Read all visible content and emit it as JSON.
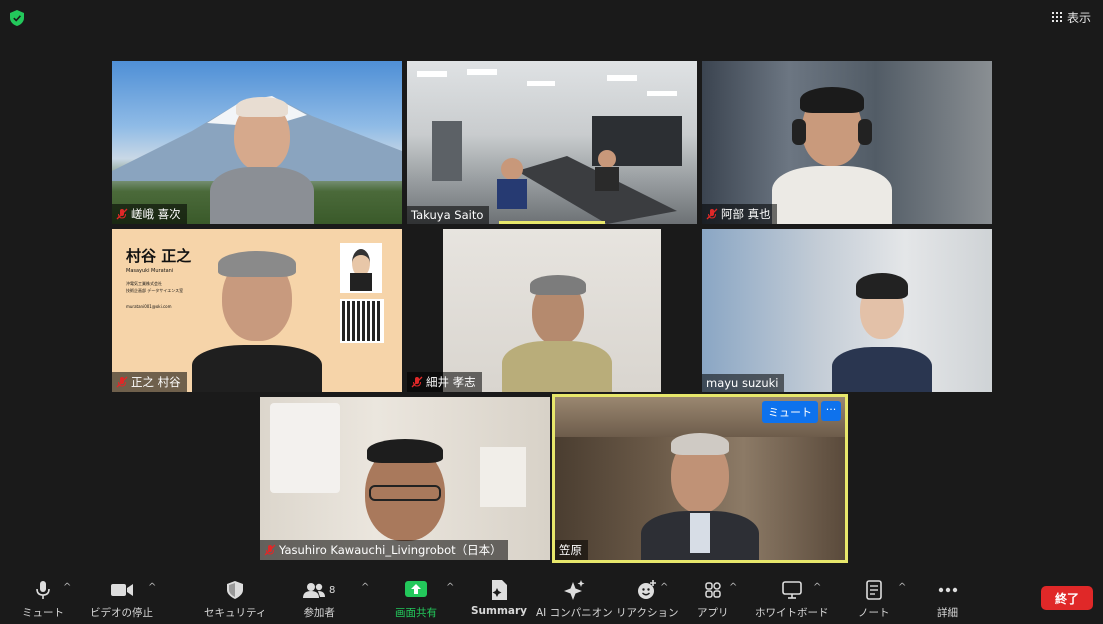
{
  "header": {
    "view_label": "表示"
  },
  "participants": [
    {
      "name": "嵯峨 喜次",
      "muted": true
    },
    {
      "name": "Takuya Saito",
      "muted": false
    },
    {
      "name": "阿部 真也",
      "muted": true
    },
    {
      "name": "正之 村谷",
      "muted": true
    },
    {
      "name": "細井 孝志",
      "muted": true
    },
    {
      "name": "mayu suzuki",
      "muted": false
    },
    {
      "name": "Yasuhiro Kawauchi_Livingrobot（日本）",
      "muted": true
    },
    {
      "name": "笠原",
      "muted": false
    }
  ],
  "background_card": {
    "name_jp": "村谷 正之",
    "name_en": "Masayuki Muratani",
    "company": "沖電気工業株式会社",
    "department": "技術企画部 データサイエンス室",
    "email": "muratani001@oki.com"
  },
  "active_tile": {
    "mute_label": "ミュート",
    "more_label": "···"
  },
  "toolbar": {
    "mute": "ミュート",
    "video": "ビデオの停止",
    "security": "セキュリティ",
    "participants": "参加者",
    "participant_count": "8",
    "share": "画面共有",
    "summary": "Summary",
    "ai": "AI コンパニオン",
    "reaction": "リアクション",
    "apps": "アプリ",
    "whiteboard": "ホワイトボード",
    "notes": "ノート",
    "more": "詳細",
    "end": "終了"
  },
  "colors": {
    "active_border": "#e7e76b",
    "share_green": "#23c85b",
    "end_red": "#e02828",
    "blue": "#0e72ed"
  }
}
